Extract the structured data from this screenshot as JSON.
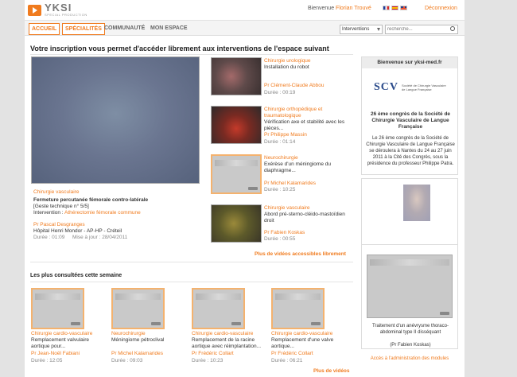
{
  "header": {
    "brand": "YKSI",
    "brand_tagline": "SPECIAL PRODUCTION",
    "welcome": "Bienvenue",
    "user": "Florian Trouvé",
    "logout": "Déconnexion"
  },
  "nav": {
    "tabs": [
      "ACCUEIL",
      "SPÉCIALITÉS",
      "COMMUNAUTÉ",
      "MON ESPACE"
    ],
    "search_scope": "Interventions",
    "search_placeholder": "recherche..."
  },
  "main": {
    "title": "Votre inscription vous permet d'accéder librement aux interventions de l'espace suivant",
    "featured": {
      "category": "Chirurgie vasculaire",
      "title": "Fermeture percutanée fémorale contro-latérale",
      "subtitle": "[Geste technique n° 5/5]",
      "intervention_label": "Intervention :",
      "intervention": "Athérectomie fémorale commune",
      "author": "Pr Pascal Desgranges",
      "hospital": "Hôpital Henri Mondor - AP-HP - Créteil",
      "duration": "Durée : 01:09",
      "date": "Mise à jour : 28/04/2011"
    },
    "videos": [
      {
        "category": "Chirurgie urologique",
        "title_lines": [
          "Installation du robot"
        ],
        "author": "Pr Clément-Claude Abbou",
        "duration": "Durée : 00:19"
      },
      {
        "category_lines": [
          "Chirurgie orthopédique et",
          "traumatologique"
        ],
        "title_lines": [
          "Vérification axe et stabilité avec les",
          "pièces..."
        ],
        "author": "Pr Philippe Massin",
        "duration": "Durée : 01:14"
      },
      {
        "category": "Neurochirurgie",
        "title_lines": [
          "Exérèse d'un méningiome du",
          "diaphragme..."
        ],
        "author": "Pr Michel Kalamarides",
        "duration": "Durée : 10:25"
      },
      {
        "category": "Chirurgie vasculaire",
        "title_lines": [
          "Abord pré-sterno-cléido-mastoïdien",
          "droit"
        ],
        "author": "Pr Fabien Koskas",
        "duration": "Durée : 00:55"
      }
    ],
    "more_videos": "Plus de vidéos accessibles librement"
  },
  "popular": {
    "title": "Les plus consultées cette semaine",
    "items": [
      {
        "category": "Chirurgie cardio-vasculaire",
        "title_lines": [
          "Remplacement valvulaire",
          "aortique pour..."
        ],
        "author": "Pr Jean-Noël Fabiani",
        "duration": "Durée : 12:05"
      },
      {
        "category": "Neurochirurgie",
        "title_lines": [
          "Méningiome pétroclival"
        ],
        "author": "Pr Michel Kalamarides",
        "duration": "Durée : 09:03"
      },
      {
        "category": "Chirurgie cardio-vasculaire",
        "title_lines": [
          "Remplacement de la racine",
          "aortique avec réimplantation..."
        ],
        "author": "Pr Frédéric Collart",
        "duration": "Durée : 10:23"
      },
      {
        "category": "Chirurgie cardio-vasculaire",
        "title_lines": [
          "Remplacement d'une valve",
          "aortique..."
        ],
        "author": "Pr Frédéric Collart",
        "duration": "Durée : 06:21"
      }
    ],
    "more": "Plus de vidéos"
  },
  "sidebar": {
    "welcome": "Bienvenue sur yksi-med.fr",
    "partner_logo": "SCV",
    "partner_name": "Société de Chirurgie Vasculaire de Langue Française",
    "congress_title": "26 ème congrès de la Société de Chirurgie Vasculaire de Langue Française",
    "congress_text": "Le 26 ème congrès de la Société de Chirurgie Vasculaire de Langue Française se déroulera à Nantes du 24 au 27 juin 2011 à la Cité des Congrès, sous la présidence du professeur Philippe Patra.",
    "video_caption": "Traitement d'un anévrysme thoraco-abdominal type II disséquant",
    "video_author": "(Pr Fabien Koskas)",
    "admin_link": "Accès à l'administration des modules"
  }
}
